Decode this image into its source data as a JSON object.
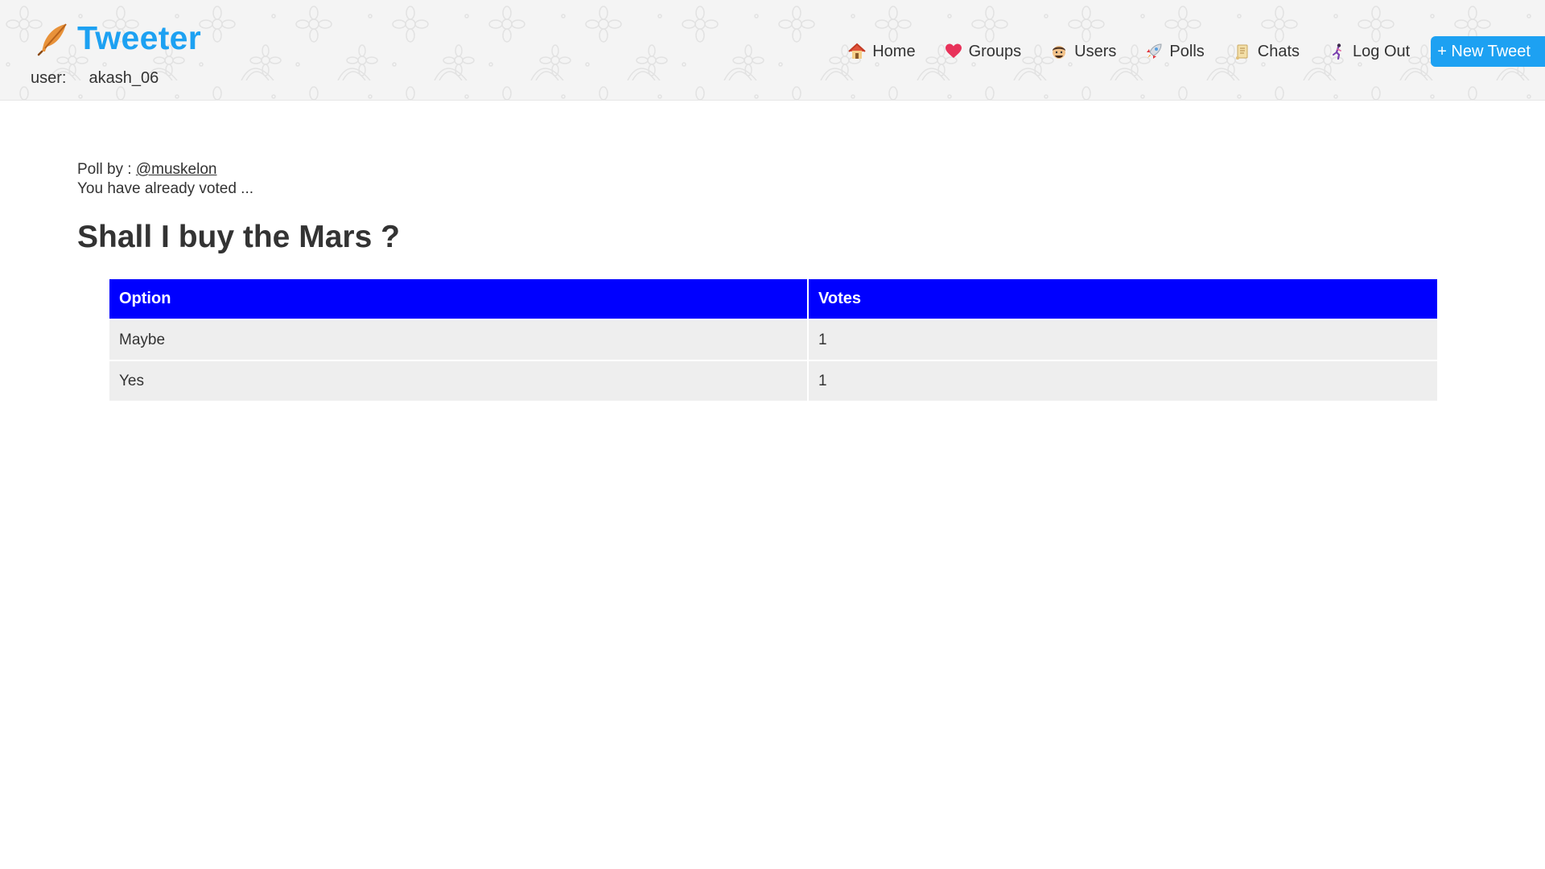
{
  "brand": {
    "name": "Tweeter",
    "icon": "feather-icon",
    "color": "#1da1f2"
  },
  "user": {
    "label": "user:",
    "username": "akash_06"
  },
  "nav": {
    "items": [
      {
        "label": "Home",
        "icon": "house-icon"
      },
      {
        "label": "Groups",
        "icon": "heart-icon"
      },
      {
        "label": "Users",
        "icon": "face-icon"
      },
      {
        "label": "Polls",
        "icon": "rocket-icon"
      },
      {
        "label": "Chats",
        "icon": "scroll-icon"
      },
      {
        "label": "Log Out",
        "icon": "runner-icon"
      }
    ],
    "new_tweet_label": "+ New Tweet"
  },
  "poll": {
    "by_label": "Poll by :",
    "author": "@muskelon",
    "status": "You have already voted ...",
    "question": "Shall I buy the Mars ?",
    "table": {
      "headers": [
        "Option",
        "Votes"
      ],
      "rows": [
        {
          "option": "Maybe",
          "votes": "1"
        },
        {
          "option": "Yes",
          "votes": "1"
        }
      ]
    }
  },
  "colors": {
    "accent": "#1da1f2",
    "table_header": "#0000ff",
    "table_row": "#eeeeee"
  }
}
